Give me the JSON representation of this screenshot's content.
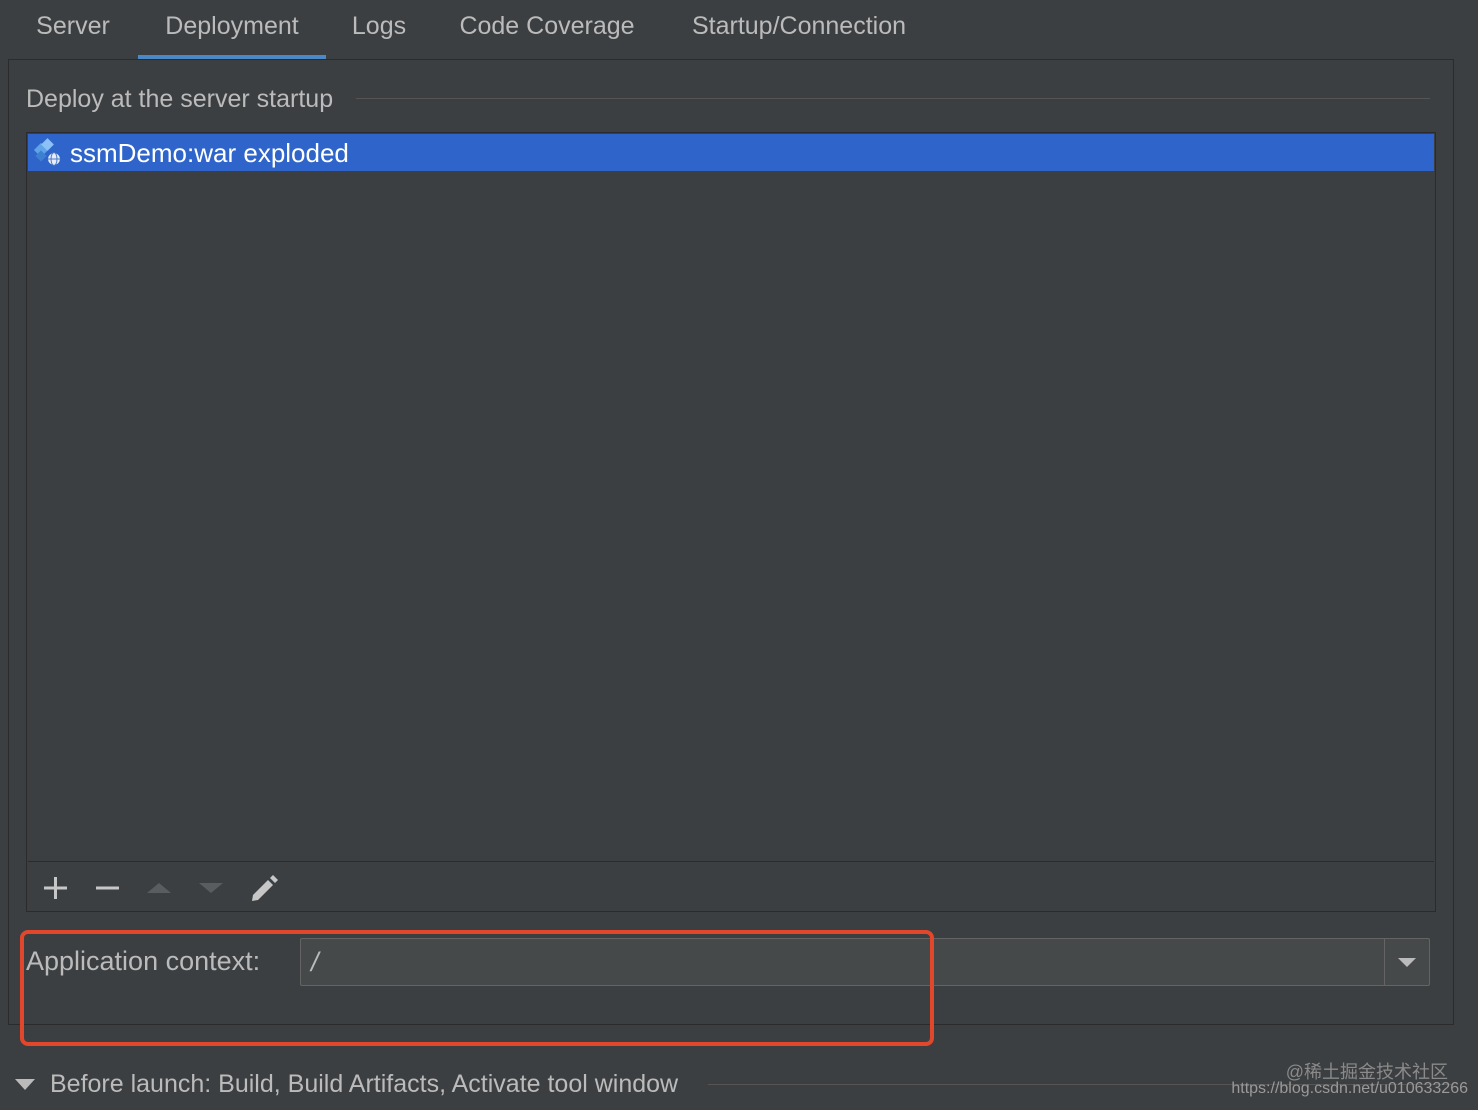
{
  "tabs": [
    {
      "label": "Server",
      "active": false
    },
    {
      "label": "Deployment",
      "active": true
    },
    {
      "label": "Logs",
      "active": false
    },
    {
      "label": "Code Coverage",
      "active": false
    },
    {
      "label": "Startup/Connection",
      "active": false
    }
  ],
  "deploy_section": {
    "title": "Deploy at the server startup",
    "artifacts": [
      {
        "label": "ssmDemo:war exploded",
        "icon": "war-exploded-artifact-icon",
        "selected": true
      }
    ],
    "toolbar": [
      {
        "name": "add-icon",
        "enabled": true
      },
      {
        "name": "remove-icon",
        "enabled": true
      },
      {
        "name": "move-up-icon",
        "enabled": false
      },
      {
        "name": "move-down-icon",
        "enabled": false
      },
      {
        "name": "edit-pencil-icon",
        "enabled": true
      }
    ]
  },
  "application_context": {
    "label": "Application context:",
    "value": "/"
  },
  "before_launch": {
    "text": "Before launch: Build, Build Artifacts, Activate tool window",
    "expanded": true
  },
  "watermark": {
    "line1": "@稀土掘金技术社区",
    "line2": "https://blog.csdn.net/u010633266"
  },
  "colors": {
    "background": "#3c3f41",
    "selection": "#2f65ca",
    "tab_underline": "#4a88c7",
    "highlight_box": "#e2472c"
  }
}
